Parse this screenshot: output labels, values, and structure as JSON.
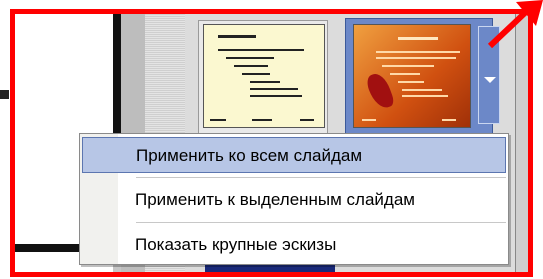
{
  "context_menu": {
    "items": [
      {
        "label": "Применить ко всем слайдам",
        "selected": true
      },
      {
        "label": "Применить к выделенным слайдам",
        "selected": false
      },
      {
        "label": "Показать крупные эскизы",
        "selected": false
      }
    ]
  },
  "colors": {
    "highlight_frame": "#ff0000",
    "selection": "#b7c6e6",
    "thumbnail_selected": "#6c88c8"
  },
  "icons": {
    "dropdown": "chevron-down-icon",
    "annotation": "red-arrow-icon"
  }
}
